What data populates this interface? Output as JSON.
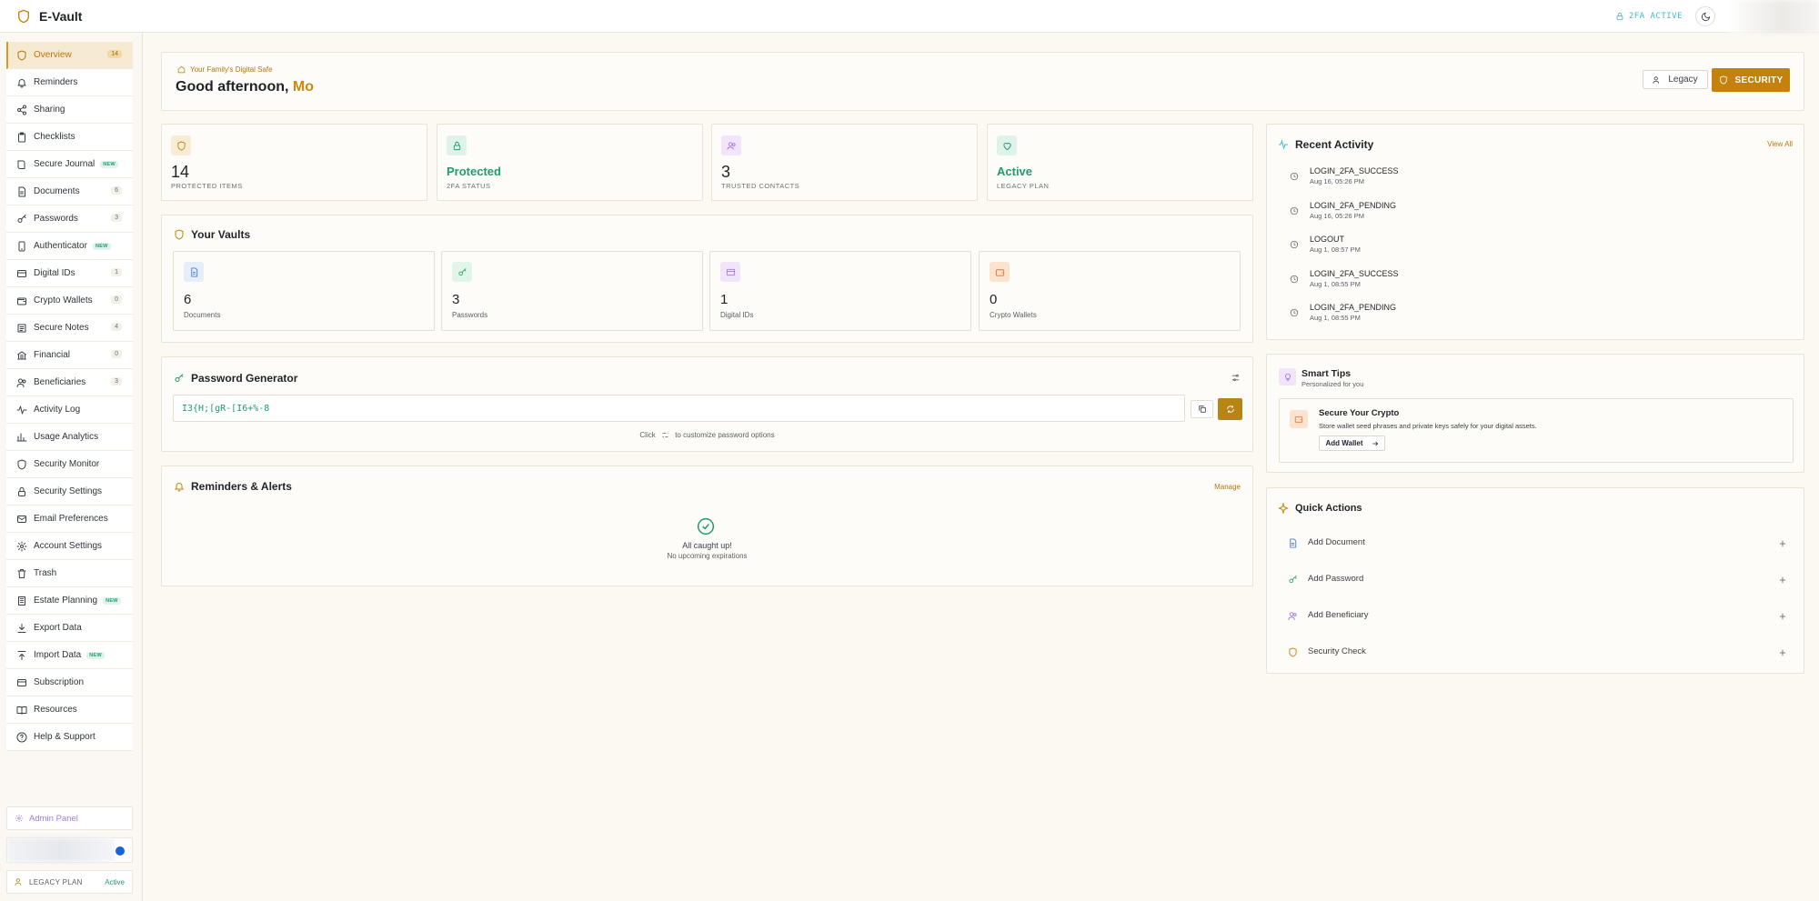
{
  "app": {
    "name": "E-Vault"
  },
  "topbar": {
    "twofa_label": "2FA ACTIVE"
  },
  "sidebar": {
    "items": [
      {
        "label": "Overview",
        "icon": "shield-icon",
        "count": "14",
        "badge": ""
      },
      {
        "label": "Reminders",
        "icon": "bell-icon",
        "count": "",
        "badge": ""
      },
      {
        "label": "Sharing",
        "icon": "share-icon",
        "count": "",
        "badge": ""
      },
      {
        "label": "Checklists",
        "icon": "clipboard-icon",
        "count": "",
        "badge": ""
      },
      {
        "label": "Secure Journal",
        "icon": "book-icon",
        "count": "",
        "badge": "NEW"
      },
      {
        "label": "Documents",
        "icon": "document-icon",
        "count": "6",
        "badge": ""
      },
      {
        "label": "Passwords",
        "icon": "key-icon",
        "count": "3",
        "badge": ""
      },
      {
        "label": "Authenticator",
        "icon": "phone-icon",
        "count": "",
        "badge": "NEW"
      },
      {
        "label": "Digital IDs",
        "icon": "id-card-icon",
        "count": "1",
        "badge": ""
      },
      {
        "label": "Crypto Wallets",
        "icon": "wallet-icon",
        "count": "0",
        "badge": ""
      },
      {
        "label": "Secure Notes",
        "icon": "note-icon",
        "count": "4",
        "badge": ""
      },
      {
        "label": "Financial",
        "icon": "bank-icon",
        "count": "0",
        "badge": ""
      },
      {
        "label": "Beneficiaries",
        "icon": "users-icon",
        "count": "3",
        "badge": ""
      },
      {
        "label": "Activity Log",
        "icon": "activity-icon",
        "count": "",
        "badge": ""
      },
      {
        "label": "Usage Analytics",
        "icon": "bar-chart-icon",
        "count": "",
        "badge": ""
      },
      {
        "label": "Security Monitor",
        "icon": "shield-icon",
        "count": "",
        "badge": ""
      },
      {
        "label": "Security Settings",
        "icon": "lock-icon",
        "count": "",
        "badge": ""
      },
      {
        "label": "Email Preferences",
        "icon": "mail-icon",
        "count": "",
        "badge": ""
      },
      {
        "label": "Account Settings",
        "icon": "gear-icon",
        "count": "",
        "badge": ""
      },
      {
        "label": "Trash",
        "icon": "trash-icon",
        "count": "",
        "badge": ""
      },
      {
        "label": "Estate Planning",
        "icon": "building-icon",
        "count": "",
        "badge": "NEW"
      },
      {
        "label": "Export Data",
        "icon": "download-icon",
        "count": "",
        "badge": ""
      },
      {
        "label": "Import Data",
        "icon": "upload-icon",
        "count": "",
        "badge": "NEW"
      },
      {
        "label": "Subscription",
        "icon": "card-icon",
        "count": "",
        "badge": ""
      },
      {
        "label": "Resources",
        "icon": "book-open-icon",
        "count": "",
        "badge": ""
      },
      {
        "label": "Help & Support",
        "icon": "help-icon",
        "count": "",
        "badge": ""
      }
    ],
    "admin_panel": "Admin Panel",
    "plan_label": "LEGACY PLAN",
    "plan_status": "Active"
  },
  "greeting": {
    "subtitle": "Your Family's Digital Safe",
    "prefix": "Good afternoon, ",
    "name": "Mo",
    "legacy_button": "Legacy",
    "security_button": "SECURITY"
  },
  "stats": [
    {
      "value": "14",
      "label": "PROTECTED ITEMS",
      "icon": "shield-icon"
    },
    {
      "value": "Protected",
      "label": "2FA STATUS",
      "icon": "lock-icon"
    },
    {
      "value": "3",
      "label": "TRUSTED CONTACTS",
      "icon": "users-icon"
    },
    {
      "value": "Active",
      "label": "LEGACY PLAN",
      "icon": "heart-icon"
    }
  ],
  "vaults": {
    "title": "Your Vaults",
    "items": [
      {
        "value": "6",
        "label": "Documents",
        "icon": "document-icon"
      },
      {
        "value": "3",
        "label": "Passwords",
        "icon": "key-icon"
      },
      {
        "value": "1",
        "label": "Digital IDs",
        "icon": "id-card-icon"
      },
      {
        "value": "0",
        "label": "Crypto Wallets",
        "icon": "wallet-icon"
      }
    ]
  },
  "password_generator": {
    "title": "Password Generator",
    "value": "I3{H;[gR-[I6+%-8",
    "hint_before": "Click",
    "hint_after": "to customize password options"
  },
  "reminders": {
    "title": "Reminders & Alerts",
    "manage_link": "Manage",
    "empty_title": "All caught up!",
    "empty_sub": "No upcoming expirations"
  },
  "recent_activity": {
    "title": "Recent Activity",
    "view_all": "View All",
    "items": [
      {
        "event": "LOGIN_2FA_SUCCESS",
        "time": "Aug 16, 05:26 PM"
      },
      {
        "event": "LOGIN_2FA_PENDING",
        "time": "Aug 16, 05:26 PM"
      },
      {
        "event": "LOGOUT",
        "time": "Aug 1, 08:57 PM"
      },
      {
        "event": "LOGIN_2FA_SUCCESS",
        "time": "Aug 1, 08:55 PM"
      },
      {
        "event": "LOGIN_2FA_PENDING",
        "time": "Aug 1, 08:55 PM"
      }
    ]
  },
  "smart_tips": {
    "title": "Smart Tips",
    "subtitle": "Personalized for you",
    "tip_title": "Secure Your Crypto",
    "tip_desc": "Store wallet seed phrases and private keys safely for your digital assets.",
    "tip_button": "Add Wallet"
  },
  "quick_actions": {
    "title": "Quick Actions",
    "items": [
      {
        "label": "Add Document",
        "icon": "document-icon"
      },
      {
        "label": "Add Password",
        "icon": "key-icon"
      },
      {
        "label": "Add Beneficiary",
        "icon": "users-icon"
      },
      {
        "label": "Security Check",
        "icon": "shield-icon"
      }
    ]
  },
  "colors": {
    "accent": "#c4820d",
    "success": "#1f9c6f",
    "info": "#3cbbd4"
  }
}
